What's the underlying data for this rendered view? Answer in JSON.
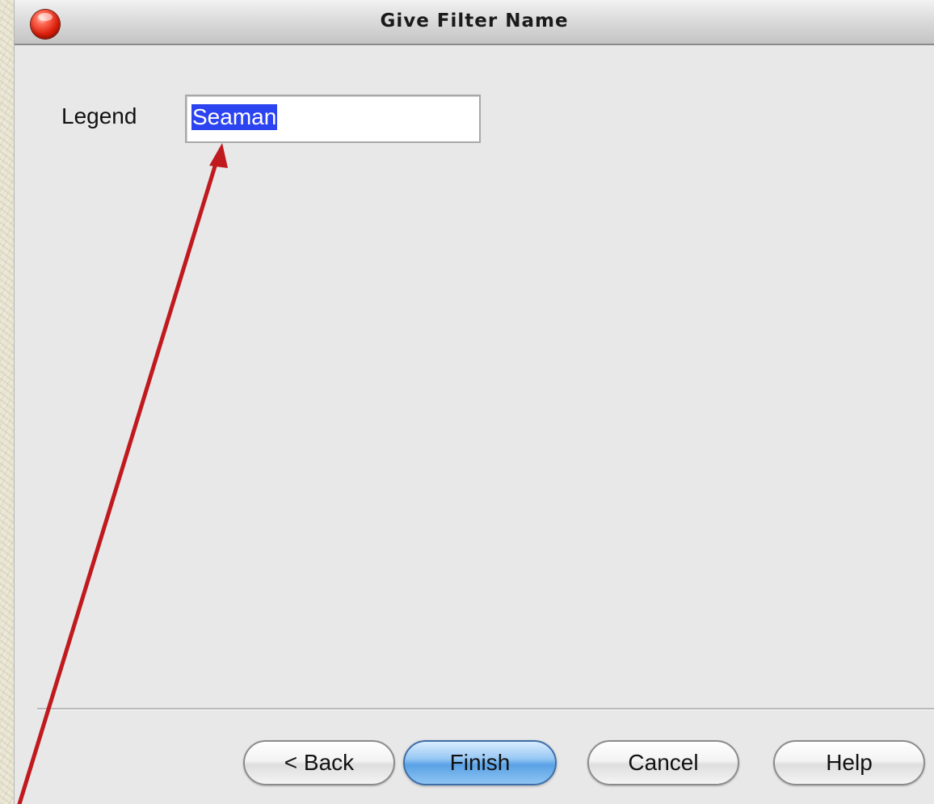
{
  "window": {
    "title": "Give Filter Name"
  },
  "form": {
    "legend_label": "Legend",
    "legend_value": "Seaman",
    "legend_value_selected": true
  },
  "buttons": {
    "back": "< Back",
    "finish": "Finish",
    "cancel": "Cancel",
    "help": "Help",
    "default": "finish"
  },
  "annotation": {
    "arrow_color": "#c0191e",
    "arrow_target": "legend-input"
  },
  "colors": {
    "selection": "#2c44f0",
    "default_button": "#5aa2e6",
    "close_button": "#d81e0a"
  },
  "icons": {
    "close": "close-icon",
    "arrow": "arrow-icon"
  }
}
